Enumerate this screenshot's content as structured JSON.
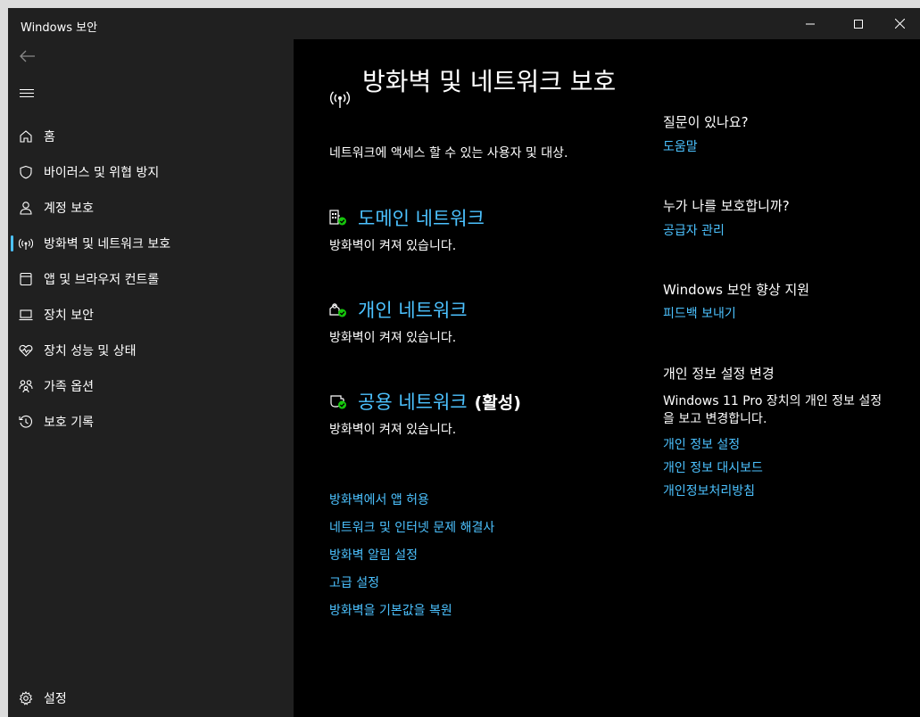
{
  "window": {
    "title": "Windows 보안"
  },
  "sidebar": {
    "items": [
      {
        "label": "홈",
        "icon": "home-icon"
      },
      {
        "label": "바이러스 및 위협 방지",
        "icon": "shield-icon"
      },
      {
        "label": "계정 보호",
        "icon": "person-icon"
      },
      {
        "label": "방화벽 및 네트워크 보호",
        "icon": "antenna-icon",
        "active": true
      },
      {
        "label": "앱 및 브라우저 컨트롤",
        "icon": "browser-icon"
      },
      {
        "label": "장치 보안",
        "icon": "laptop-icon"
      },
      {
        "label": "장치 성능 및 상태",
        "icon": "heart-pulse-icon"
      },
      {
        "label": "가족 옵션",
        "icon": "family-icon"
      },
      {
        "label": "보호 기록",
        "icon": "history-icon"
      }
    ],
    "settings": "설정"
  },
  "main": {
    "title": "방화벽 및 네트워크 보호",
    "subtitle": "네트워크에 액세스 할 수 있는 사용자 및 대상.",
    "networks": [
      {
        "name": "도메인 네트워크",
        "status": "방화벽이 켜져 있습니다.",
        "active_label": ""
      },
      {
        "name": "개인 네트워크",
        "status": "방화벽이 켜져 있습니다.",
        "active_label": ""
      },
      {
        "name": "공용 네트워크",
        "status": "방화벽이 켜져 있습니다.",
        "active_label": "(활성)"
      }
    ],
    "links": [
      "방화벽에서 앱 허용",
      "네트워크 및 인터넷 문제 해결사",
      "방화벽 알림 설정",
      "고급 설정",
      "방화벽을 기본값을 복원"
    ]
  },
  "right": {
    "question": {
      "heading": "질문이 있나요?",
      "link": "도움말"
    },
    "protect": {
      "heading": "누가 나를 보호합니까?",
      "link": "공급자 관리"
    },
    "improve": {
      "heading": "Windows 보안 향상 지원",
      "link": "피드백 보내기"
    },
    "privacy": {
      "heading": "개인 정보 설정 변경",
      "text": "Windows 11 Pro 장치의 개인 정보 설정을 보고 변경합니다.",
      "links": [
        "개인 정보 설정",
        "개인 정보 대시보드",
        "개인정보처리방침"
      ]
    }
  },
  "colors": {
    "accent": "#4cc2ff",
    "ok": "#16c60c",
    "sidebar_bg": "#202020",
    "main_bg": "#000000"
  }
}
